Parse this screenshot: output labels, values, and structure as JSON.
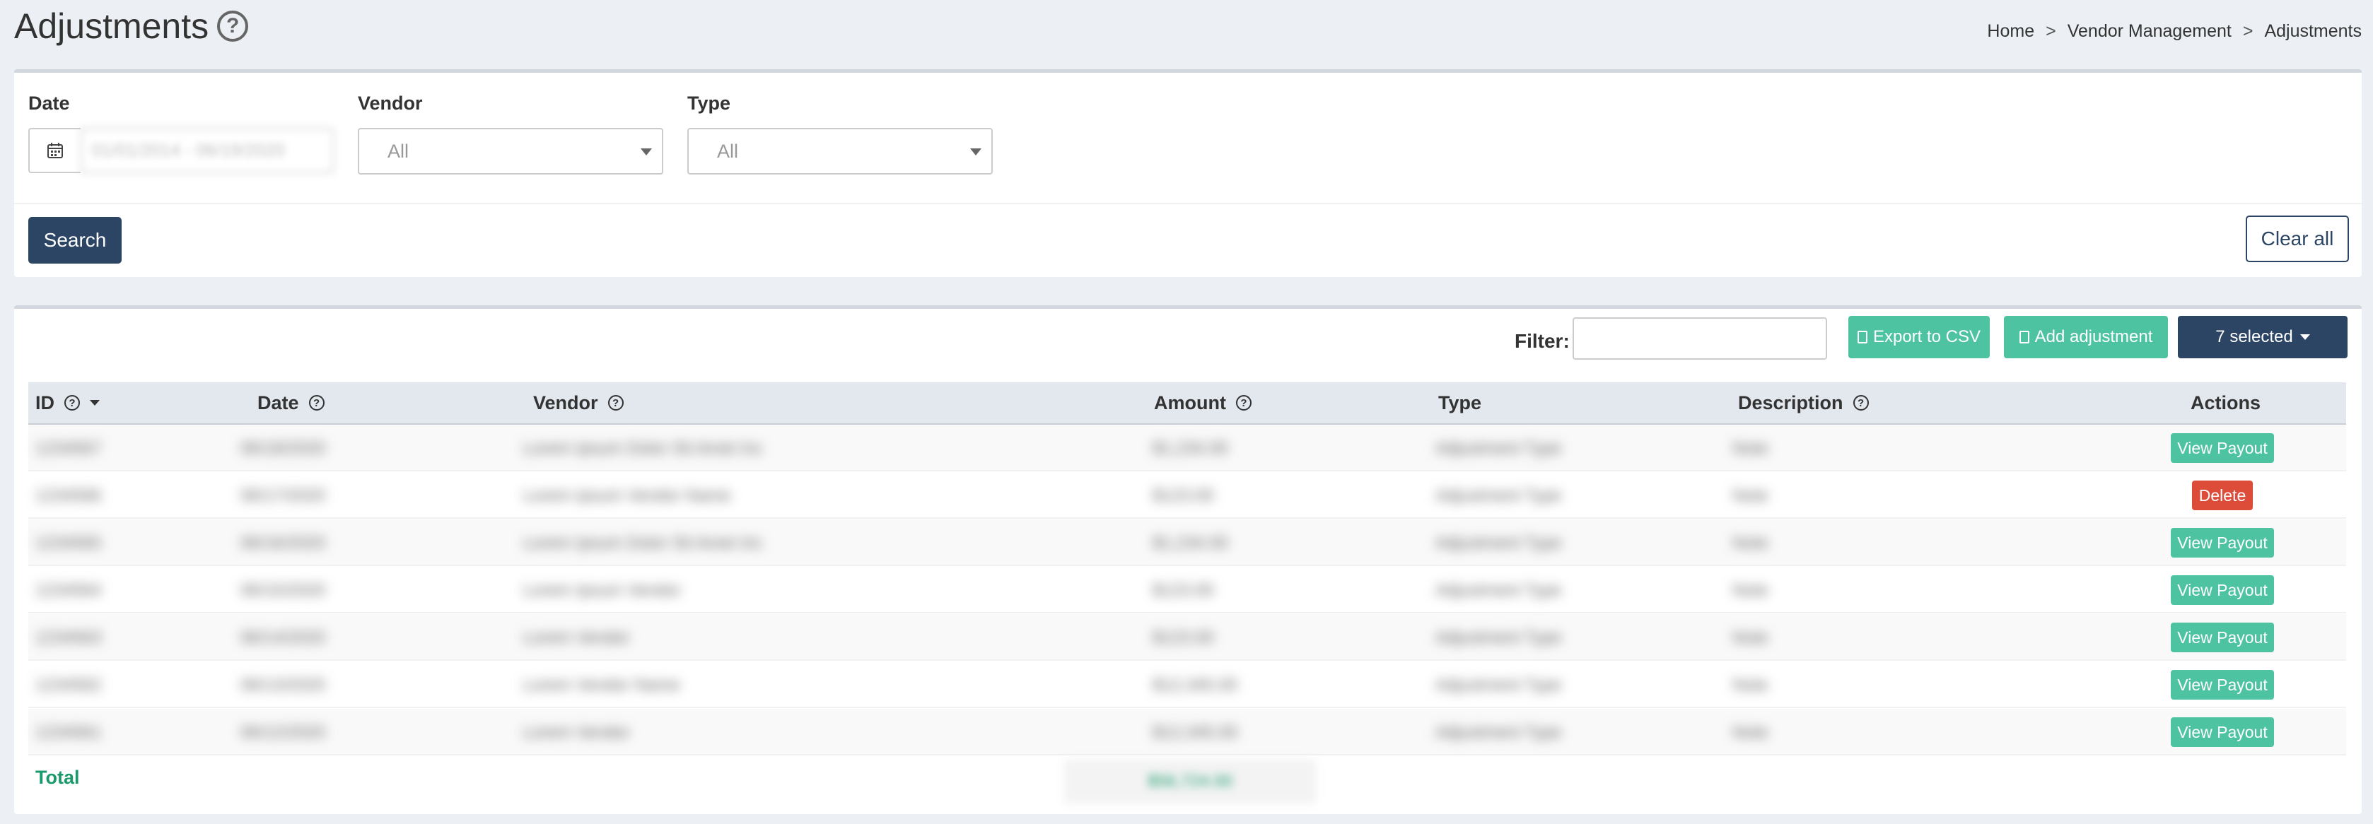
{
  "page": {
    "title": "Adjustments",
    "help": "?"
  },
  "breadcrumb": [
    "Home",
    ">",
    "Vendor Management",
    ">",
    "Adjustments"
  ],
  "filters": {
    "date_label": "Date",
    "date_value": "01/01/2014 - 06/19/2020",
    "vendor_label": "Vendor",
    "vendor_value": "All",
    "type_label": "Type",
    "type_value": "All",
    "search_button": "Search",
    "clear_button": "Clear all"
  },
  "toolbar": {
    "filter_label": "Filter:",
    "export_button": "Export to CSV",
    "add_button": "Add adjustment",
    "selected_button": "7 selected"
  },
  "table": {
    "columns": [
      "ID",
      "Date",
      "Vendor",
      "Amount",
      "Type",
      "Description",
      "Actions"
    ],
    "help_glyph": "?",
    "rows": [
      {
        "id": "1234567",
        "date": "06/18/2020",
        "vendor": "Lorem Ipsum Dolor Sit Amet Inc",
        "amount": "$1,234.00",
        "type": "Adjustment Type",
        "description": "Note",
        "action": "View Payout"
      },
      {
        "id": "1234566",
        "date": "06/17/2020",
        "vendor": "Lorem Ipsum Vendor Name",
        "amount": "$123.00",
        "type": "Adjustment Type",
        "description": "Note",
        "action": "Delete"
      },
      {
        "id": "1234565",
        "date": "06/16/2020",
        "vendor": "Lorem Ipsum Dolor Sit Amet Inc",
        "amount": "$1,234.00",
        "type": "Adjustment Type",
        "description": "Note",
        "action": "View Payout"
      },
      {
        "id": "1234564",
        "date": "06/15/2020",
        "vendor": "Lorem Ipsum Vendor",
        "amount": "$123.00",
        "type": "Adjustment Type",
        "description": "Note",
        "action": "View Payout"
      },
      {
        "id": "1234563",
        "date": "06/14/2020",
        "vendor": "Lorem Vendor",
        "amount": "$123.00",
        "type": "Adjustment Type",
        "description": "Note",
        "action": "View Payout"
      },
      {
        "id": "1234562",
        "date": "06/13/2020",
        "vendor": "Lorem Vendor Name",
        "amount": "$12,345.00",
        "type": "Adjustment Type",
        "description": "Note",
        "action": "View Payout"
      },
      {
        "id": "1234561",
        "date": "06/12/2020",
        "vendor": "Lorem Vendor",
        "amount": "$12,345.00",
        "type": "Adjustment Type",
        "description": "Note",
        "action": "View Payout"
      }
    ],
    "total_label": "Total",
    "total_amount": "$56,724.00"
  }
}
